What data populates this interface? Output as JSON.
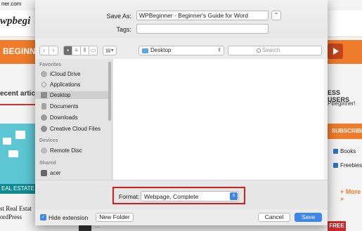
{
  "background_page": {
    "url_fragment": "ner.com",
    "logo": "wpbegi",
    "orange_band_text": "BEGINNE",
    "recent_articles": "ecent article",
    "real_estate": "EAL ESTATE",
    "title_line1": "st Real Estat",
    "title_line2": "ordPress",
    "right_heading": "ESS USERS",
    "right_sub": "PBeginner!",
    "subscribe": "SUBSCRIBE",
    "checkbox_books": "Books",
    "checkbox_freebies": "Freebies",
    "more": "+ More »",
    "free_badge": "FREE",
    "bottom_text": "..."
  },
  "dialog": {
    "save_as_label": "Save As:",
    "save_as_value": "WPBeginner - Beginner's Guide for Word",
    "tags_label": "Tags:",
    "tags_value": "",
    "location": "Desktop",
    "search_placeholder": "Search",
    "sidebar": {
      "favorites_title": "Favorites",
      "favorites": [
        "iCloud Drive",
        "Applications",
        "Desktop",
        "Documents",
        "Downloads",
        "Creative Cloud Files"
      ],
      "devices_title": "Devices",
      "devices": [
        "Remote Disc"
      ],
      "shared_title": "Shared",
      "shared": [
        "acer"
      ],
      "selected": "Desktop"
    },
    "format_label": "Format:",
    "format_value": "Webpage, Complete",
    "hide_extension_label": "Hide extension",
    "hide_extension_checked": true,
    "new_folder_label": "New Folder",
    "cancel_label": "Cancel",
    "save_label": "Save",
    "accent_color": "#3e86e8",
    "highlight_color": "#d21e1e"
  }
}
